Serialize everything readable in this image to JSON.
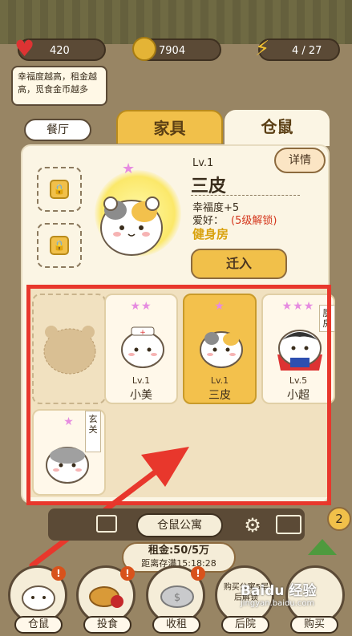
{
  "stats": {
    "hearts": "420",
    "coins": "7904",
    "energy": "4 / 27"
  },
  "tip_text": "幸福度越高，租金越高，觅食金币越多",
  "tabs": {
    "restaurant": "餐厅",
    "furniture": "家具",
    "hamster": "仓鼠"
  },
  "detail": {
    "level": "Lv.1",
    "name": "三皮",
    "happiness": "幸福度+5",
    "hobby_label": "爱好：",
    "hobby_value": "(5级解锁)",
    "room": "健身房",
    "details_button": "详情",
    "move_in_button": "迁入"
  },
  "hamsters": [
    {
      "level": "Lv.1",
      "name": "小美",
      "stars": "★★"
    },
    {
      "level": "Lv.1",
      "name": "三皮",
      "stars": "★"
    },
    {
      "level": "Lv.5",
      "name": "小超",
      "stars": "★★★"
    },
    {
      "stars": "★"
    }
  ],
  "room_tags": {
    "kitchen": "厨房",
    "entrance": "玄关"
  },
  "apartment_label": "仓鼠公寓",
  "rent": {
    "amount": "租金:50/5万",
    "until_full": "距离存满15:18:28"
  },
  "notification_count": "2",
  "nav": {
    "hamster": "仓鼠",
    "feed": "投食",
    "rent": "收租",
    "backyard": "后院",
    "purchase": "购买",
    "buy_note": "购买公寓5层后解锁"
  },
  "watermark": {
    "brand": "Baidu 经验",
    "url": "jingyan.baidu.com"
  },
  "colors": {
    "accent": "#f1c04a",
    "highlight_frame": "#e8372c",
    "hobby_text": "#d4361c",
    "room_text": "#d9a20e"
  }
}
